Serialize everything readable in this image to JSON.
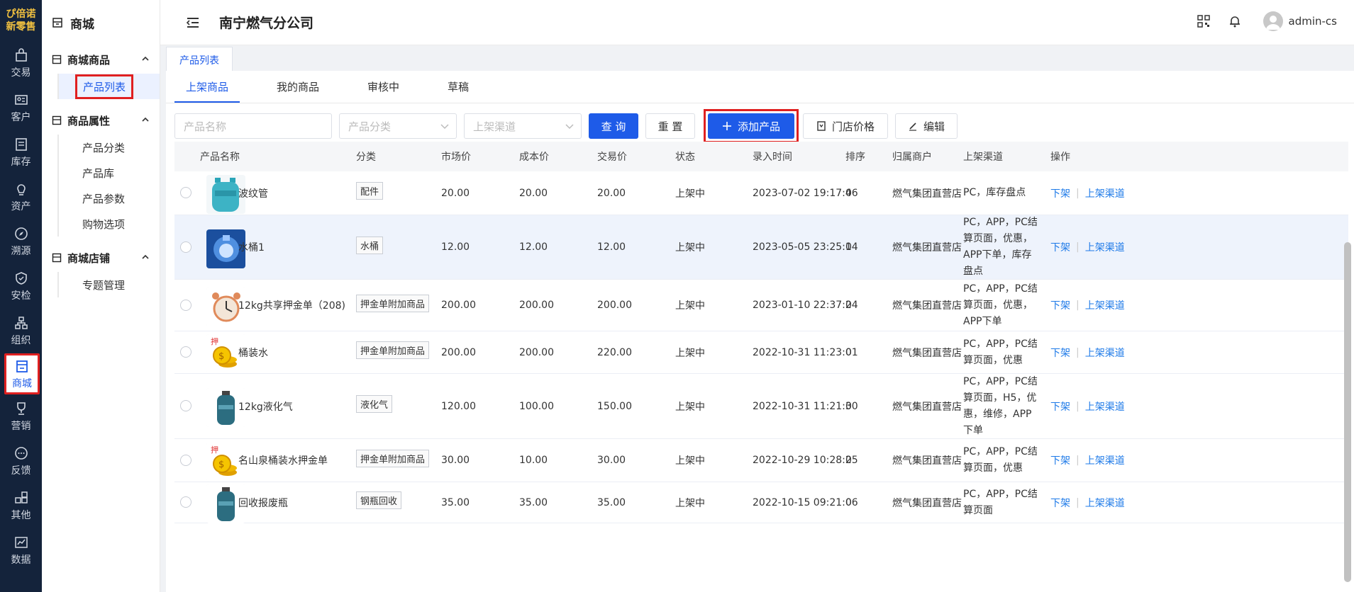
{
  "brand": {
    "logo_line1": "ぴ倍诺",
    "logo_line2": "新零售",
    "accent": "#1e5be8",
    "sidebar_bg": "#14233b",
    "highlight": "#e02020"
  },
  "leftnav": [
    {
      "label": "交易",
      "icon": "bag-icon"
    },
    {
      "label": "客户",
      "icon": "idcard-icon"
    },
    {
      "label": "库存",
      "icon": "list-icon"
    },
    {
      "label": "资产",
      "icon": "bulb-icon"
    },
    {
      "label": "溯源",
      "icon": "compass-icon"
    },
    {
      "label": "安检",
      "icon": "shield-icon"
    },
    {
      "label": "组织",
      "icon": "org-icon"
    },
    {
      "label": "商城",
      "icon": "store-icon",
      "active": true
    },
    {
      "label": "营销",
      "icon": "trophy-icon"
    },
    {
      "label": "反馈",
      "icon": "chat-icon"
    },
    {
      "label": "其他",
      "icon": "apps-icon"
    },
    {
      "label": "数据",
      "icon": "chart-icon"
    }
  ],
  "menu": {
    "title": "商城",
    "groups": [
      {
        "label": "商城商品",
        "items": [
          "产品列表"
        ]
      },
      {
        "label": "商品属性",
        "items": [
          "产品分类",
          "产品库",
          "产品参数",
          "购物选项"
        ]
      },
      {
        "label": "商城店铺",
        "items": [
          "专题管理"
        ]
      }
    ]
  },
  "header": {
    "company": "南宁燃气分公司",
    "user": "admin-cs"
  },
  "page_tab": "产品列表",
  "tabs": [
    "上架商品",
    "我的商品",
    "审核中",
    "草稿"
  ],
  "filters": {
    "name_placeholder": "产品名称",
    "category_placeholder": "产品分类",
    "channel_placeholder": "上架渠道",
    "query": "查 询",
    "reset": "重 置",
    "add": "添加产品",
    "store_price": "门店价格",
    "edit": "编辑"
  },
  "columns": [
    "产品名称",
    "分类",
    "市场价",
    "成本价",
    "交易价",
    "状态",
    "录入时间",
    "排序",
    "归属商户",
    "上架渠道",
    "操作"
  ],
  "ops": {
    "down": "下架",
    "channel": "上架渠道"
  },
  "rows": [
    {
      "name": "波纹管",
      "category": "配件",
      "market": "20.00",
      "cost": "20.00",
      "trade": "20.00",
      "status": "上架中",
      "time": "2023-07-02 19:17:46",
      "sort": "0",
      "merchant": "燃气集团直营店",
      "channel": [
        "PC，库存盘点"
      ],
      "img": "tank-teal"
    },
    {
      "name": "水桶1",
      "category": "水桶",
      "market": "12.00",
      "cost": "12.00",
      "trade": "12.00",
      "status": "上架中",
      "time": "2023-05-05 23:25:14",
      "sort": "0",
      "merchant": "燃气集团直营店",
      "channel": [
        "PC，APP，PC结",
        "算页面，优惠，",
        "APP下单，库存",
        "盘点"
      ],
      "img": "water-blue"
    },
    {
      "name": "12kg共享押金单（208)",
      "category": "押金单附加商品",
      "market": "200.00",
      "cost": "200.00",
      "trade": "200.00",
      "status": "上架中",
      "time": "2023-01-10 22:37:24",
      "sort": "0",
      "merchant": "燃气集团直营店",
      "channel": [
        "PC，APP，PC结",
        "算页面，优惠，",
        "APP下单"
      ],
      "img": "clock"
    },
    {
      "name": "桶装水",
      "category": "押金单附加商品",
      "market": "200.00",
      "cost": "200.00",
      "trade": "220.00",
      "status": "上架中",
      "time": "2022-10-31 11:23:01",
      "sort": "0",
      "merchant": "燃气集团直营店",
      "channel": [
        "PC，APP，PC结",
        "算页面，优惠"
      ],
      "img": "coins"
    },
    {
      "name": "12kg液化气",
      "category": "液化气",
      "market": "120.00",
      "cost": "100.00",
      "trade": "150.00",
      "status": "上架中",
      "time": "2022-10-31 11:21:30",
      "sort": "0",
      "merchant": "燃气集团直营店",
      "channel": [
        "PC，APP，PC结",
        "算页面，H5，优",
        "惠，维修，APP",
        "下单"
      ],
      "img": "cylinder"
    },
    {
      "name": "名山泉桶装水押金单",
      "category": "押金单附加商品",
      "market": "30.00",
      "cost": "10.00",
      "trade": "30.00",
      "status": "上架中",
      "time": "2022-10-29 10:28:25",
      "sort": "0",
      "merchant": "燃气集团直营店",
      "channel": [
        "PC，APP，PC结",
        "算页面，优惠"
      ],
      "img": "coins"
    },
    {
      "name": "回收报废瓶",
      "category": "钢瓶回收",
      "market": "35.00",
      "cost": "35.00",
      "trade": "35.00",
      "status": "上架中",
      "time": "2022-10-15 09:21:06",
      "sort": "0",
      "merchant": "燃气集团直营店",
      "channel": [
        "PC，APP，PC结",
        "算页面"
      ],
      "img": "cylinder"
    }
  ]
}
